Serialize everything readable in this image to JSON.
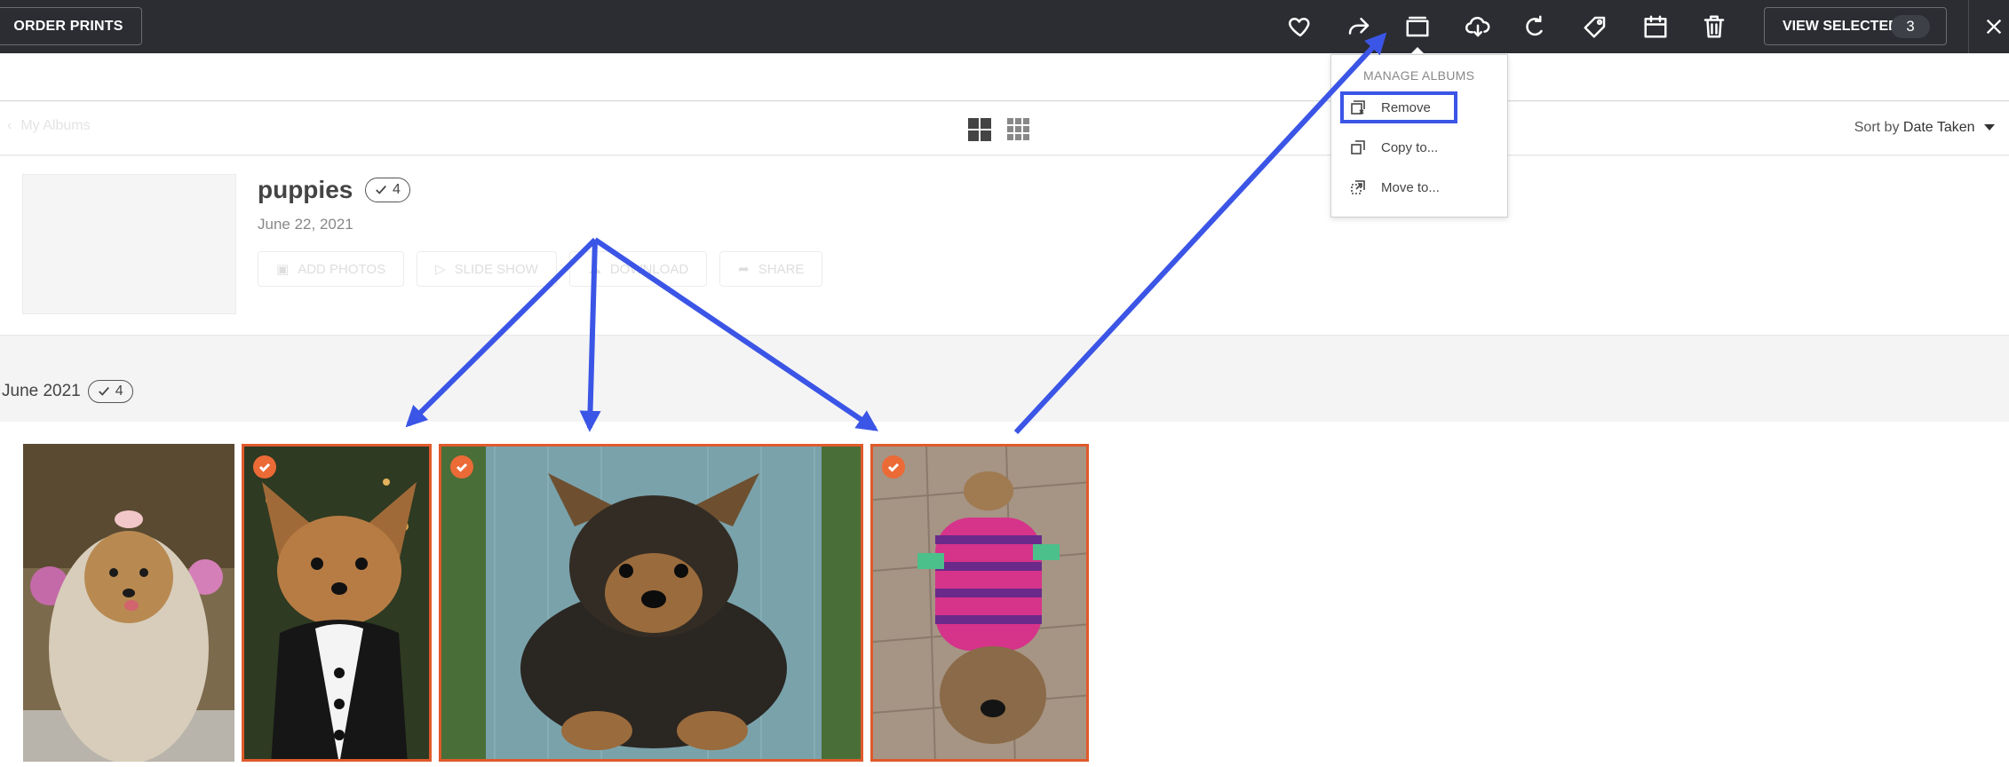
{
  "toolbar": {
    "order_prints": "ORDER PRINTS",
    "view_selected": "VIEW SELECTED",
    "selected_count": "3",
    "icons": [
      "heart-icon",
      "share-icon",
      "album-icon",
      "download-icon",
      "rotate-icon",
      "tag-icon",
      "calendar-icon",
      "trash-icon",
      "close-icon"
    ]
  },
  "menu": {
    "header": "MANAGE ALBUMS",
    "items": [
      {
        "label": "Remove",
        "icon": "remove-from-album-icon"
      },
      {
        "label": "Copy to...",
        "icon": "copy-icon"
      },
      {
        "label": "Move to...",
        "icon": "move-icon"
      }
    ]
  },
  "viewbar": {
    "back_label": "My Albums",
    "sort_prefix": "Sort by",
    "sort_value": "Date Taken"
  },
  "album": {
    "title": "puppies",
    "count": "4",
    "date": "June 22, 2021",
    "actions": [
      "ADD PHOTOS",
      "SLIDE SHOW",
      "DOWNLOAD",
      "SHARE"
    ]
  },
  "group": {
    "month": "June 2021",
    "count": "4"
  },
  "photos": [
    {
      "name": "yorkie-with-bow",
      "selected": false
    },
    {
      "name": "yorkie-in-tuxedo",
      "selected": true
    },
    {
      "name": "yorkie-puppy-on-chair",
      "selected": true
    },
    {
      "name": "yorkie-in-striped-shirt",
      "selected": true
    }
  ],
  "colors": {
    "topbar": "#2b2d33",
    "selection_border": "#e05a2b",
    "annotation_blue": "#3b55e6"
  }
}
